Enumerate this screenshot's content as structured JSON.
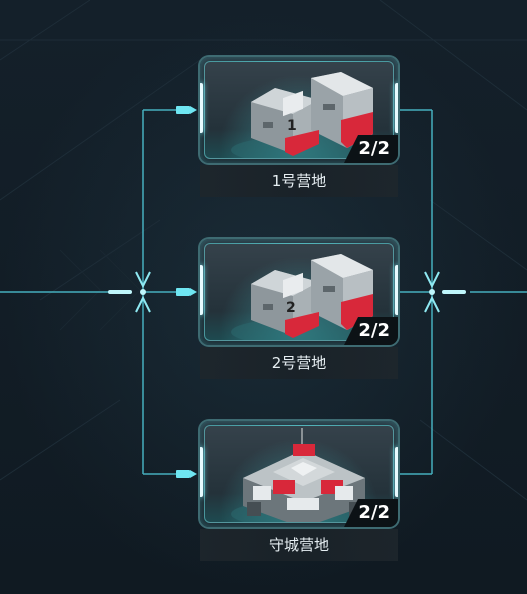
{
  "camps": [
    {
      "name": "1号营地",
      "count": "2/2",
      "icon": "camp-1-building-icon"
    },
    {
      "name": "2号营地",
      "count": "2/2",
      "icon": "camp-2-building-icon"
    },
    {
      "name": "守城营地",
      "count": "2/2",
      "icon": "city-defense-building-icon"
    }
  ],
  "colors": {
    "background": "#121c24",
    "connector": "#4fc8d8",
    "frame_glow": "#7ff0ff",
    "badge_bg": "#0c1216",
    "label_text": "#e6eef2",
    "building_red": "#d8283a"
  }
}
